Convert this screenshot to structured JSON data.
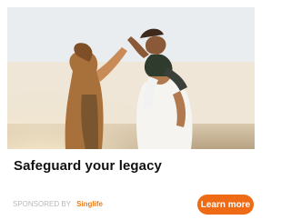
{
  "ad": {
    "headline": "Safeguard your legacy",
    "sponsored_label": "SPONSORED BY",
    "sponsor_name": "Singlife",
    "cta_label": "Learn more",
    "colors": {
      "cta_background": "#ef6a14",
      "sponsor_name": "#f07c18",
      "sponsored_label": "#b9b9b9",
      "headline": "#111111"
    }
  }
}
